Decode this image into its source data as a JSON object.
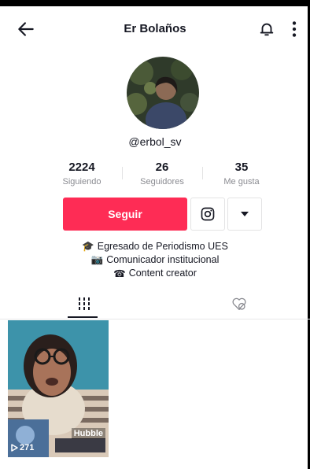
{
  "header": {
    "title": "Er Bolaños",
    "icons": {
      "back": "arrow-left-icon",
      "bell": "bell-icon",
      "more": "more-vertical-icon"
    }
  },
  "profile": {
    "username": "@erbol_sv",
    "stats": [
      {
        "value": "2224",
        "label": "Siguiendo"
      },
      {
        "value": "26",
        "label": "Seguidores"
      },
      {
        "value": "35",
        "label": "Me gusta"
      }
    ]
  },
  "actions": {
    "follow_label": "Seguir",
    "accent": "#fe2c55",
    "instagram_icon": "instagram-icon",
    "dropdown_icon": "caret-down-icon"
  },
  "bio": {
    "lines": [
      {
        "emoji": "🎓",
        "text": "Egresado de Periodismo UES"
      },
      {
        "emoji": "📷",
        "text": "Comunicador institucional"
      },
      {
        "emoji": "☎",
        "text": "Content creator"
      }
    ]
  },
  "tabs": {
    "videos_icon": "grid-icon",
    "liked_icon": "liked-heart-icon"
  },
  "videos": [
    {
      "overlay_text": "Hubble",
      "views": "271"
    }
  ]
}
